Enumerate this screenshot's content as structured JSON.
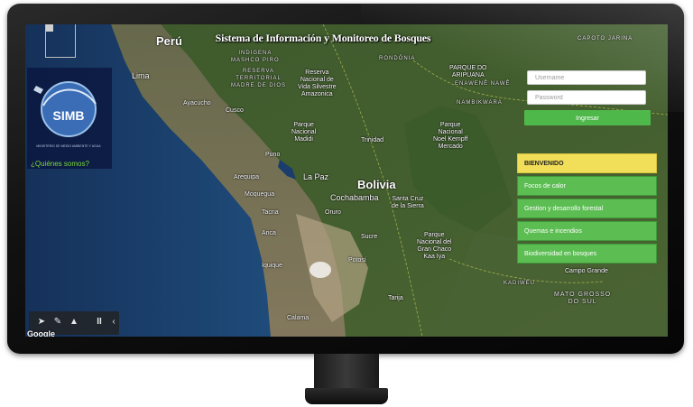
{
  "app": {
    "title": "Sistema de Información y Monitoreo de Bosques",
    "logo_text": "SIMB",
    "logo_caption": "MINISTERIO DE MEDIO AMBIENTE Y AGUA",
    "about_link": "¿Quiénes somos?"
  },
  "login": {
    "username_placeholder": "Username",
    "password_placeholder": "Password",
    "submit_label": "Ingresar"
  },
  "menu": {
    "header": "BIENVENIDO",
    "items": [
      "Focos de calor",
      "Gestion y desarrollo forestal",
      "Quemas e incendios",
      "Biodiversidad en bosques"
    ]
  },
  "map": {
    "labels": {
      "peru": "Perú",
      "bolivia": "Bolivia",
      "lima": "Lima",
      "la_paz": "La Paz",
      "cochabamba": "Cochabamba",
      "santa_cruz": "Santa Cruz\nde la Sierra",
      "cusco": "Cusco",
      "arequipa": "Arequipa",
      "puno": "Puno",
      "tacna": "Tacna",
      "oruro": "Oruro",
      "sucre": "Sucre",
      "potosi": "Potosí",
      "iquique": "Iquique",
      "tarija": "Tarija",
      "trinidad": "Trinidad",
      "ayacucho": "Ayacucho",
      "moquegua": "Moquegua",
      "arica": "Arica",
      "calama": "Calama",
      "campo_grande": "Campo Grande",
      "madidi": "Parque\nNacional\nMadidi",
      "kempff": "Parque\nNacional\nNoel Kempff\nMercado",
      "kaa_iya": "Parque\nNacional del\nGran Chaco\nKaa Iya",
      "tambopata": "Reserva\nNacional de\nVida Silvestre\nAmazonica",
      "madre_dios": "RESERVA\nTERRITORIAL\nMADRE DE DIOS",
      "mashco": "INDIGENA\nMASHCO PIRO",
      "nambikwara": "NAMBIKWARA",
      "enawene": "ENAWENÊ NAWÊ",
      "kadiweu": "KADIWÉU",
      "capoto": "CAPOTO JARINA",
      "rondonia": "RONDÔNIA",
      "mato_grosso_sul": "MATO GROSSO\nDO SUL",
      "aripuana": "PARQUE DO\nARIPUANA",
      "google": "Google"
    }
  },
  "toolbar": {
    "pause_label": "II",
    "collapse_label": "‹"
  },
  "colors": {
    "accent_green": "#5cbd53",
    "header_yellow": "#f1df5a",
    "link_green": "#7cd83a"
  }
}
